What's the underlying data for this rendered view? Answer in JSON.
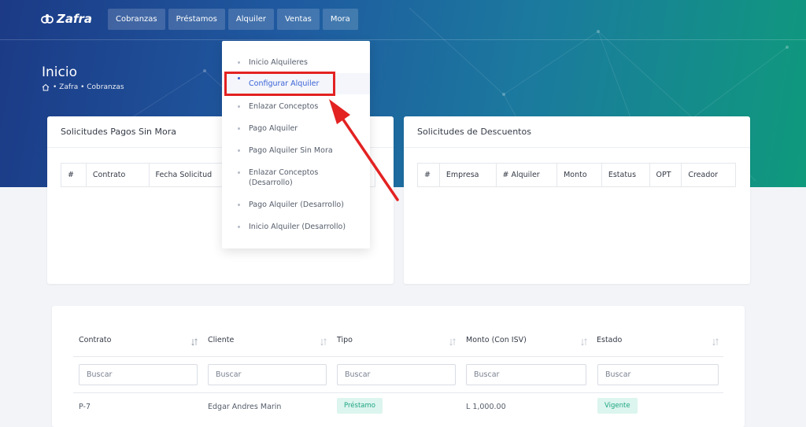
{
  "brand": {
    "name": "Zafra"
  },
  "nav": [
    "Cobranzas",
    "Préstamos",
    "Alquiler",
    "Ventas",
    "Mora"
  ],
  "page": {
    "title": "Inicio",
    "breadcrumb": "• Zafra • Cobranzas"
  },
  "dropdown": {
    "items": [
      "Inicio Alquileres",
      "Configurar Alquiler",
      "Enlazar Conceptos",
      "Pago Alquiler",
      "Pago Alquiler Sin Mora",
      "Enlazar Conceptos (Desarrollo)",
      "Pago Alquiler (Desarrollo)",
      "Inicio Alquiler (Desarrollo)"
    ],
    "active": "Configurar Alquiler"
  },
  "card_pagos": {
    "title": "Solicitudes Pagos Sin Mora",
    "columns": [
      "#",
      "Contrato",
      "Fecha Solicitud"
    ]
  },
  "card_descuentos": {
    "title": "Solicitudes de Descuentos",
    "columns": [
      "#",
      "Empresa",
      "# Alquiler",
      "Monto",
      "Estatus",
      "OPT",
      "Creador"
    ]
  },
  "main_table": {
    "columns": [
      "Contrato",
      "Cliente",
      "Tipo",
      "Monto (Con ISV)",
      "Estado"
    ],
    "search_placeholder": "Buscar",
    "rows": [
      {
        "contrato": "P-7",
        "cliente": "Edgar Andres Marin",
        "tipo": "Préstamo",
        "monto": "L 1,000.00",
        "estado": "Vigente"
      }
    ]
  },
  "colors": {
    "accent": "#3a62d6",
    "highlight": "#e32222",
    "badge_bg": "#dcf5ee",
    "badge_fg": "#1ea582"
  }
}
